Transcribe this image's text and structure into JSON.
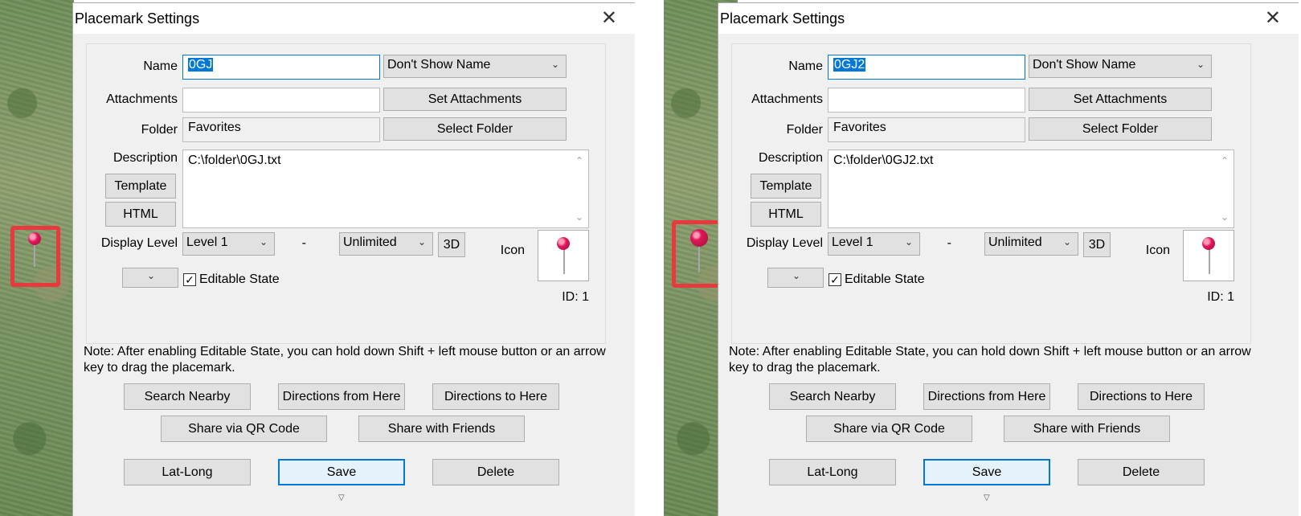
{
  "panels": [
    {
      "dialog_title": "Placemark Settings",
      "close_glyph": "✕",
      "name_label": "Name",
      "name_value": "0GJ",
      "name_display_option": "Don't Show Name",
      "attachments_label": "Attachments",
      "attachments_value": "",
      "set_attachments_label": "Set Attachments",
      "folder_label": "Folder",
      "folder_value": "Favorites",
      "select_folder_label": "Select Folder",
      "description_label": "Description",
      "description_value": "C:\\folder\\0GJ.txt",
      "template_label": "Template",
      "html_label": "HTML",
      "display_level_label": "Display Level",
      "display_level_from": "Level 1",
      "range_separator": "-",
      "display_level_to": "Unlimited",
      "3d_label": "3D",
      "icon_label": "Icon",
      "editable_state_label": "Editable State",
      "editable_state_checked": true,
      "id_text": "ID: 1",
      "note_text": "Note: After enabling Editable State, you can hold down Shift + left mouse button or an arrow key to drag the placemark.",
      "search_nearby_label": "Search Nearby",
      "directions_from_label": "Directions from Here",
      "directions_to_label": "Directions to Here",
      "share_qr_label": "Share via QR Code",
      "share_friends_label": "Share with Friends",
      "lat_long_label": "Lat-Long",
      "save_label": "Save",
      "delete_label": "Delete"
    },
    {
      "dialog_title": "Placemark Settings",
      "close_glyph": "✕",
      "name_label": "Name",
      "name_value": "0GJ2",
      "name_display_option": "Don't Show Name",
      "attachments_label": "Attachments",
      "attachments_value": "",
      "set_attachments_label": "Set Attachments",
      "folder_label": "Folder",
      "folder_value": "Favorites",
      "select_folder_label": "Select Folder",
      "description_label": "Description",
      "description_value": "C:\\folder\\0GJ2.txt",
      "template_label": "Template",
      "html_label": "HTML",
      "display_level_label": "Display Level",
      "display_level_from": "Level 1",
      "range_separator": "-",
      "display_level_to": "Unlimited",
      "3d_label": "3D",
      "icon_label": "Icon",
      "editable_state_label": "Editable State",
      "editable_state_checked": true,
      "id_text": "ID: 1",
      "note_text": "Note: After enabling Editable State, you can hold down Shift + left mouse button or an arrow key to drag the placemark.",
      "search_nearby_label": "Search Nearby",
      "directions_from_label": "Directions from Here",
      "directions_to_label": "Directions to Here",
      "share_qr_label": "Share via QR Code",
      "share_friends_label": "Share with Friends",
      "lat_long_label": "Lat-Long",
      "save_label": "Save",
      "delete_label": "Delete"
    }
  ],
  "colors": {
    "accent": "#0078d7",
    "highlight_frame": "#e8393d",
    "pin": "#e0185b",
    "dialog_bg": "#f0f0f0"
  },
  "icons": [
    "placemark-pin-icon",
    "close-icon",
    "chevron-down-icon",
    "checkmark-icon",
    "scroll-up-icon",
    "scroll-down-icon",
    "resize-grip-icon"
  ]
}
